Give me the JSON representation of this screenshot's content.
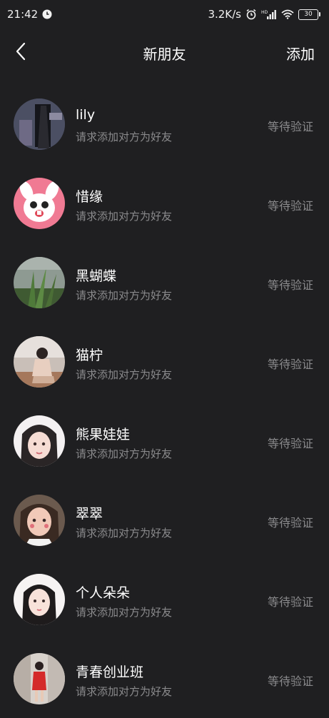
{
  "status_bar": {
    "time": "21:42",
    "speed": "3.2K/s",
    "battery": "30"
  },
  "header": {
    "title": "新朋友",
    "action": "添加"
  },
  "requests": [
    {
      "name": "lily",
      "message": "请求添加对方为好友",
      "status": "等待验证"
    },
    {
      "name": "惜缘",
      "message": "请求添加对方为好友",
      "status": "等待验证"
    },
    {
      "name": "黑蝴蝶",
      "message": "请求添加对方为好友",
      "status": "等待验证"
    },
    {
      "name": "猫柠",
      "message": "请求添加对方为好友",
      "status": "等待验证"
    },
    {
      "name": "熊果娃娃",
      "message": "请求添加对方为好友",
      "status": "等待验证"
    },
    {
      "name": "翠翠",
      "message": "请求添加对方为好友",
      "status": "等待验证"
    },
    {
      "name": "个人朵朵",
      "message": "请求添加对方为好友",
      "status": "等待验证"
    },
    {
      "name": "青春创业班",
      "message": "请求添加对方为好友",
      "status": "等待验证"
    }
  ]
}
